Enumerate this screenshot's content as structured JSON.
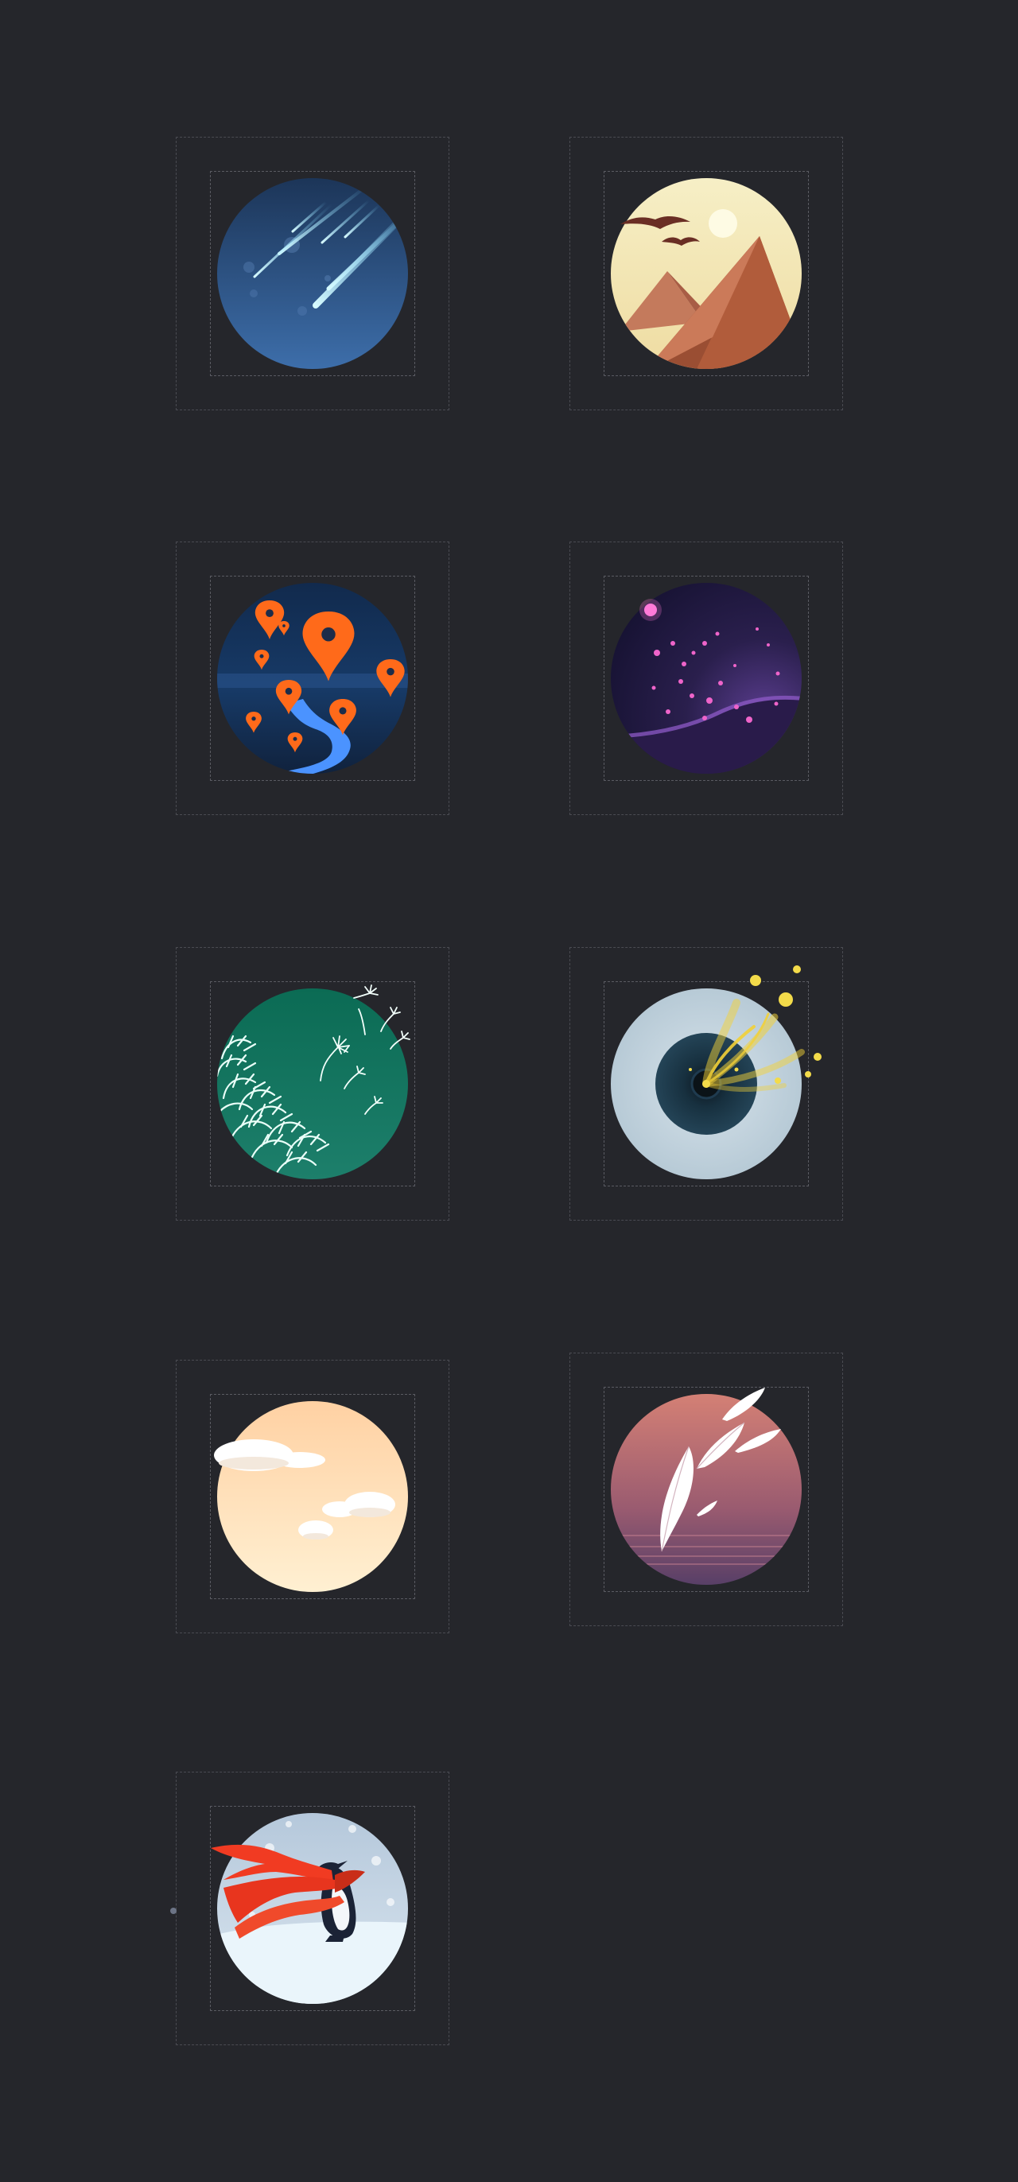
{
  "page": {
    "background": "#25262b"
  },
  "icons": [
    {
      "id": "meteor-shower",
      "icon": "meteor-shower-icon",
      "colors": [
        "#23456f",
        "#3f70a8",
        "#bfefff"
      ]
    },
    {
      "id": "desert-pyramids",
      "icon": "pyramid-sunset-icon",
      "colors": [
        "#f3e8b7",
        "#a45a3c",
        "#f7f5da"
      ]
    },
    {
      "id": "map-pins-river",
      "icon": "map-pins-icon",
      "colors": [
        "#102749",
        "#ff6a1a",
        "#4a93ff"
      ]
    },
    {
      "id": "purple-galaxy",
      "icon": "galaxy-icon",
      "colors": [
        "#1f173d",
        "#6e3c9a",
        "#ff70d6"
      ]
    },
    {
      "id": "dandelion-wind",
      "icon": "dandelion-icon",
      "colors": [
        "#0f6a56",
        "#1d7f6b",
        "#ffffff"
      ]
    },
    {
      "id": "black-hole",
      "icon": "black-hole-icon",
      "colors": [
        "#c4d3dc",
        "#1a2b37",
        "#f1d43a"
      ]
    },
    {
      "id": "peach-clouds",
      "icon": "clouds-icon",
      "colors": [
        "#ffd0a3",
        "#fff1d3",
        "#ffffff"
      ]
    },
    {
      "id": "falling-feathers",
      "icon": "feather-icon",
      "colors": [
        "#d27f75",
        "#5b3f68",
        "#ffffff"
      ]
    },
    {
      "id": "penguin-scarf",
      "icon": "penguin-icon",
      "colors": [
        "#b9cde0",
        "#f23e22",
        "#d9ecf7"
      ]
    }
  ]
}
